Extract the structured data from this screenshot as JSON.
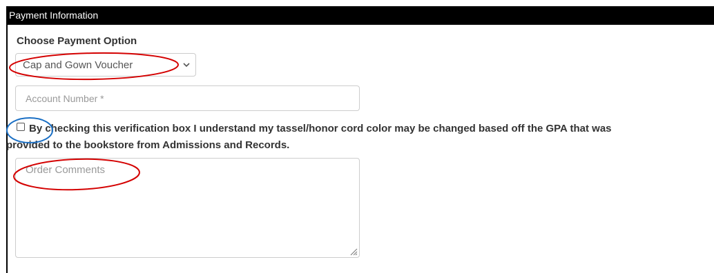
{
  "header": {
    "title": "Payment Information"
  },
  "payment": {
    "label": "Choose Payment Option",
    "selected_option": "Cap and Gown Voucher"
  },
  "account": {
    "placeholder": "Account Number *"
  },
  "verification": {
    "line1": "By checking this verification box I understand my tassel/honor cord color may be changed based off the GPA that was",
    "line2": "provided to the bookstore from Admissions and Records."
  },
  "comments": {
    "placeholder": "Order Comments"
  },
  "colors": {
    "header_bg": "#000000",
    "annotation_red": "#d40000",
    "annotation_blue": "#1a6fc4"
  }
}
